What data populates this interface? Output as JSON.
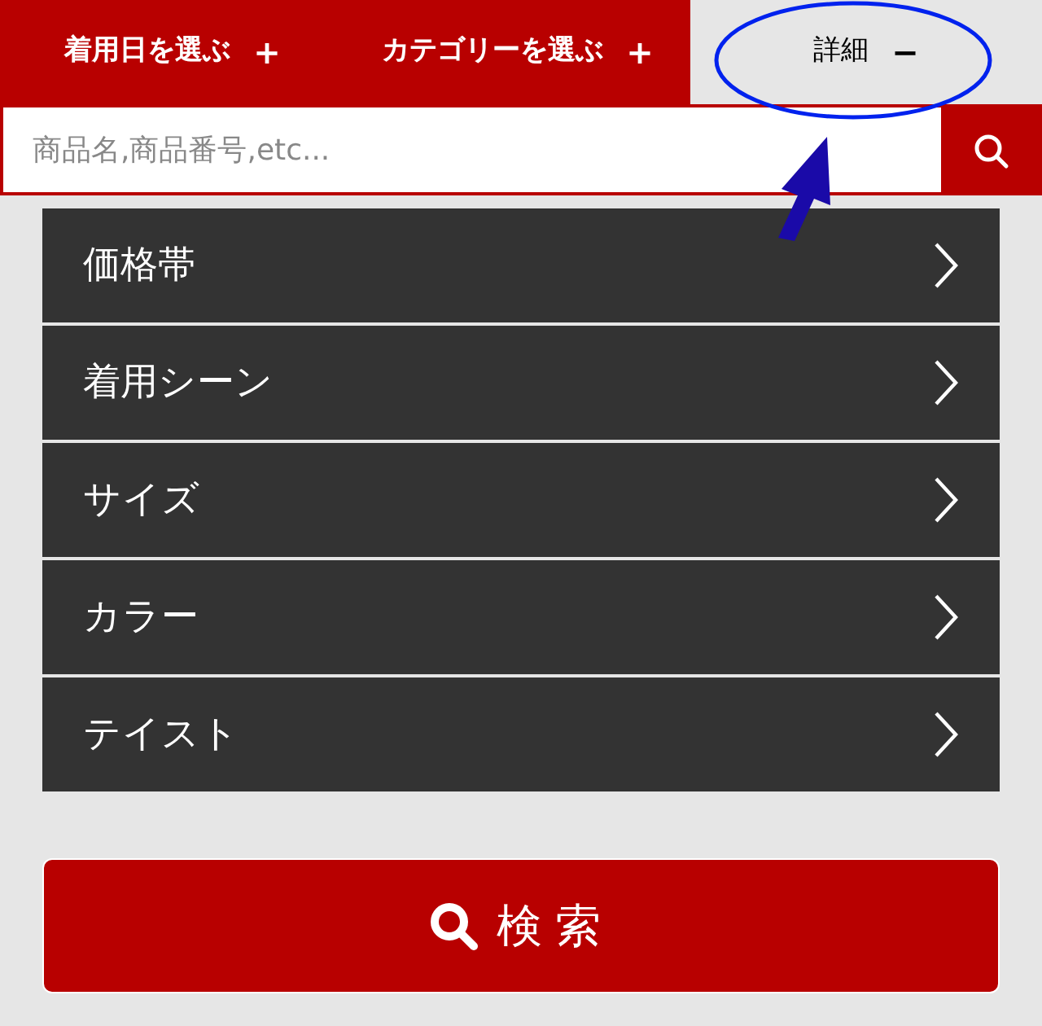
{
  "tabs": [
    {
      "label": "着用日を選ぶ",
      "sign": "+",
      "selected": false
    },
    {
      "label": "カテゴリーを選ぶ",
      "sign": "+",
      "selected": false
    },
    {
      "label": "詳細",
      "sign": "−",
      "selected": true
    }
  ],
  "search": {
    "placeholder": "商品名,商品番号,etc..."
  },
  "filters": [
    {
      "label": "価格帯"
    },
    {
      "label": "着用シーン"
    },
    {
      "label": "サイズ"
    },
    {
      "label": "カラー"
    },
    {
      "label": "テイスト"
    }
  ],
  "submit": {
    "label": "検索"
  }
}
